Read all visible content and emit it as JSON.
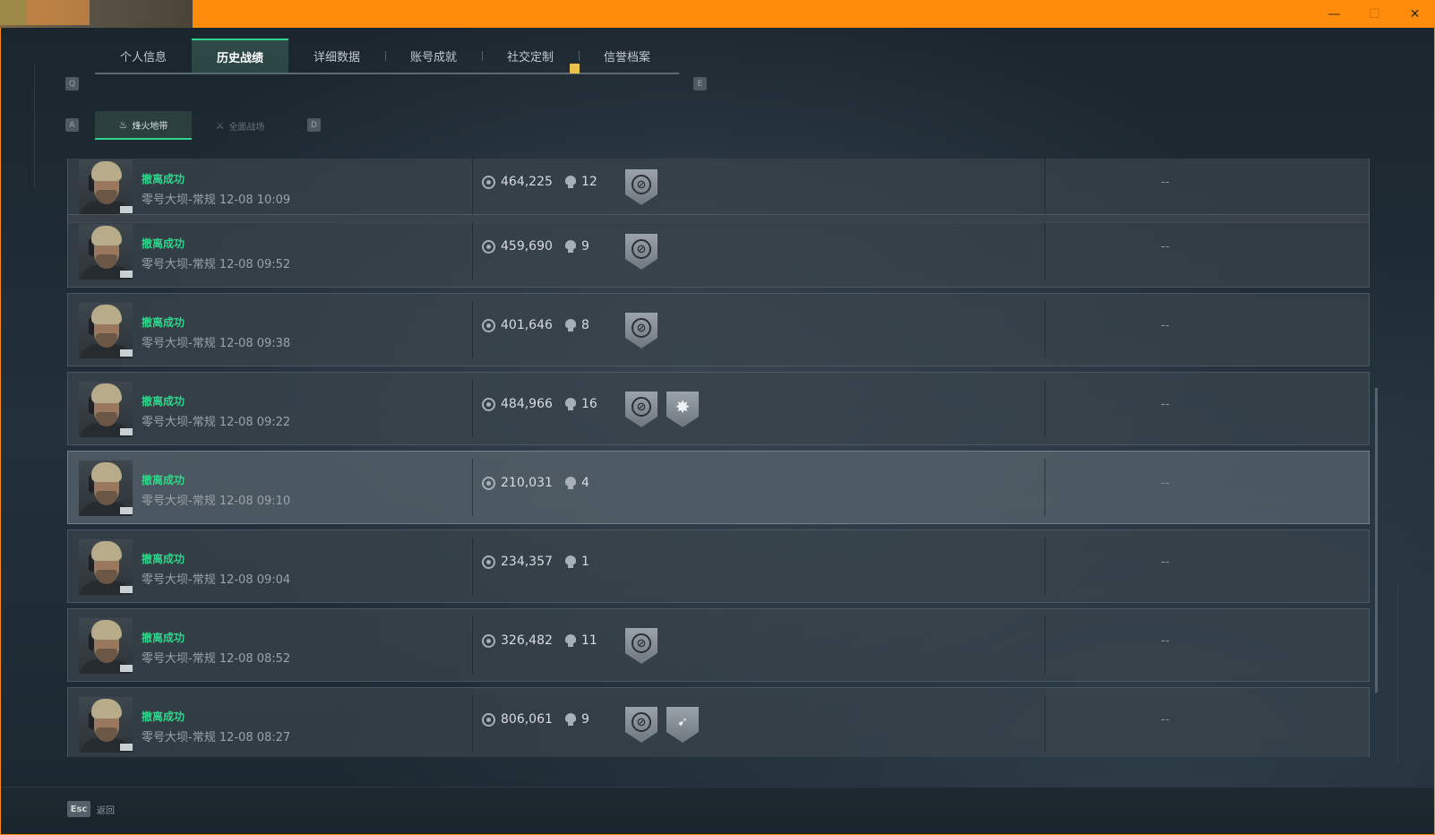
{
  "window": {
    "controls": {
      "minimize": "—",
      "maximize": "☐",
      "close": "✕"
    }
  },
  "nav": {
    "prev_key": "Q",
    "next_key": "E",
    "tabs": [
      {
        "label": "个人信息",
        "active": false
      },
      {
        "label": "历史战绩",
        "active": true
      },
      {
        "label": "详细数据",
        "active": false
      },
      {
        "label": "账号成就",
        "active": false
      },
      {
        "label": "社交定制",
        "active": false
      },
      {
        "label": "信誉档案",
        "active": false
      }
    ]
  },
  "subnav": {
    "prev_key": "A",
    "next_key": "D",
    "tabs": [
      {
        "label": "烽火地带",
        "icon": "flame-mode-icon",
        "active": true
      },
      {
        "label": "全面战场",
        "icon": "battlefield-mode-icon",
        "active": false
      }
    ]
  },
  "matches": [
    {
      "status": "撤离成功",
      "detail": "零号大坝-常规 12-08 10:09",
      "value": "464,225",
      "kills": "12",
      "badges": [
        "extraction"
      ],
      "note": "--"
    },
    {
      "status": "撤离成功",
      "detail": "零号大坝-常规 12-08 09:52",
      "value": "459,690",
      "kills": "9",
      "badges": [
        "extraction"
      ],
      "note": "--"
    },
    {
      "status": "撤离成功",
      "detail": "零号大坝-常规 12-08 09:38",
      "value": "401,646",
      "kills": "8",
      "badges": [
        "extraction"
      ],
      "note": "--"
    },
    {
      "status": "撤离成功",
      "detail": "零号大坝-常规 12-08 09:22",
      "value": "484,966",
      "kills": "16",
      "badges": [
        "extraction",
        "star"
      ],
      "note": "--"
    },
    {
      "status": "撤离成功",
      "detail": "零号大坝-常规 12-08 09:10",
      "value": "210,031",
      "kills": "4",
      "badges": [],
      "note": "--",
      "highlighted": true
    },
    {
      "status": "撤离成功",
      "detail": "零号大坝-常规 12-08 09:04",
      "value": "234,357",
      "kills": "1",
      "badges": [],
      "note": "--"
    },
    {
      "status": "撤离成功",
      "detail": "零号大坝-常规 12-08 08:52",
      "value": "326,482",
      "kills": "11",
      "badges": [
        "extraction"
      ],
      "note": "--"
    },
    {
      "status": "撤离成功",
      "detail": "零号大坝-常规 12-08 08:27",
      "value": "806,061",
      "kills": "9",
      "badges": [
        "extraction",
        "weapon"
      ],
      "note": "--"
    }
  ],
  "footer": {
    "key": "Esc",
    "label": "返回"
  },
  "colors": {
    "accent": "#2fd58a",
    "titlebar": "#ff8c0a",
    "tab_marker": "#e8c04a"
  }
}
